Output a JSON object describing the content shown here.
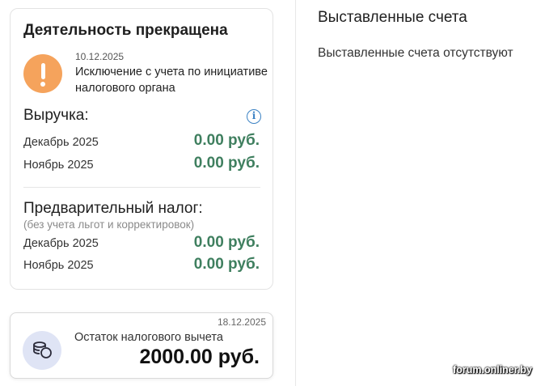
{
  "status_card": {
    "title": "Деятельность прекращена",
    "event": {
      "date": "10.12.2025",
      "text": "Исключение с учета по инициативе налогового органа",
      "icon": "warning-exclamation-icon",
      "icon_color": "#f5a35c"
    },
    "revenue": {
      "title": "Выручка:",
      "info_icon": "info-icon",
      "rows": [
        {
          "label": "Декабрь 2025",
          "value": "0.00 руб."
        },
        {
          "label": "Ноябрь 2025",
          "value": "0.00 руб."
        }
      ]
    },
    "prelim_tax": {
      "title": "Предварительный налог:",
      "note": "(без учета льгот и корректировок)",
      "rows": [
        {
          "label": "Декабрь 2025",
          "value": "0.00 руб."
        },
        {
          "label": "Ноябрь 2025",
          "value": "0.00 руб."
        }
      ]
    },
    "value_color": "#3f7f5f"
  },
  "deduction_card": {
    "date": "18.12.2025",
    "label": "Остаток налогового вычета",
    "amount": "2000.00 руб.",
    "icon": "coins-icon"
  },
  "invoices": {
    "title": "Выставленные счета",
    "empty_text": "Выставленные счета отсутствуют"
  },
  "watermark": "forum.onliner.by"
}
